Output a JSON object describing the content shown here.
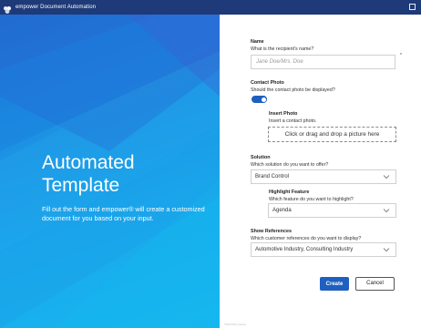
{
  "window": {
    "title": "empower Document Automation",
    "icon": "empower-logo-icon",
    "accent": "#1e5fbf"
  },
  "hero": {
    "title": "Automated Template",
    "description": "Fill out the form and empower® will create a customized document for you based on your input."
  },
  "form": {
    "name": {
      "label": "Name",
      "question": "What is the recipient's name?",
      "placeholder": "Jane Doe/Mrs. Doe",
      "required_marker": "*"
    },
    "contact_photo": {
      "label": "Contact Photo",
      "question": "Should the contact photo be displayed?",
      "toggle_on": true
    },
    "insert_photo": {
      "label": "Insert Photo",
      "hint": "Insert a contact photo.",
      "dropzone_text": "Click or drag and drop a picture here"
    },
    "solution": {
      "label": "Solution",
      "question": "Which solution do you want to offer?",
      "value": "Brand Control"
    },
    "highlight_feature": {
      "label": "Highlight Feature",
      "question": "Which feature do you want to highlight?",
      "value": "Agenda"
    },
    "show_references": {
      "label": "Show References",
      "question": "Which customer references do you want to display?",
      "value": "Automotive Industry, Consulting Industry"
    },
    "buttons": {
      "create": "Create",
      "cancel": "Cancel"
    },
    "footer": "Third Party Notice"
  }
}
